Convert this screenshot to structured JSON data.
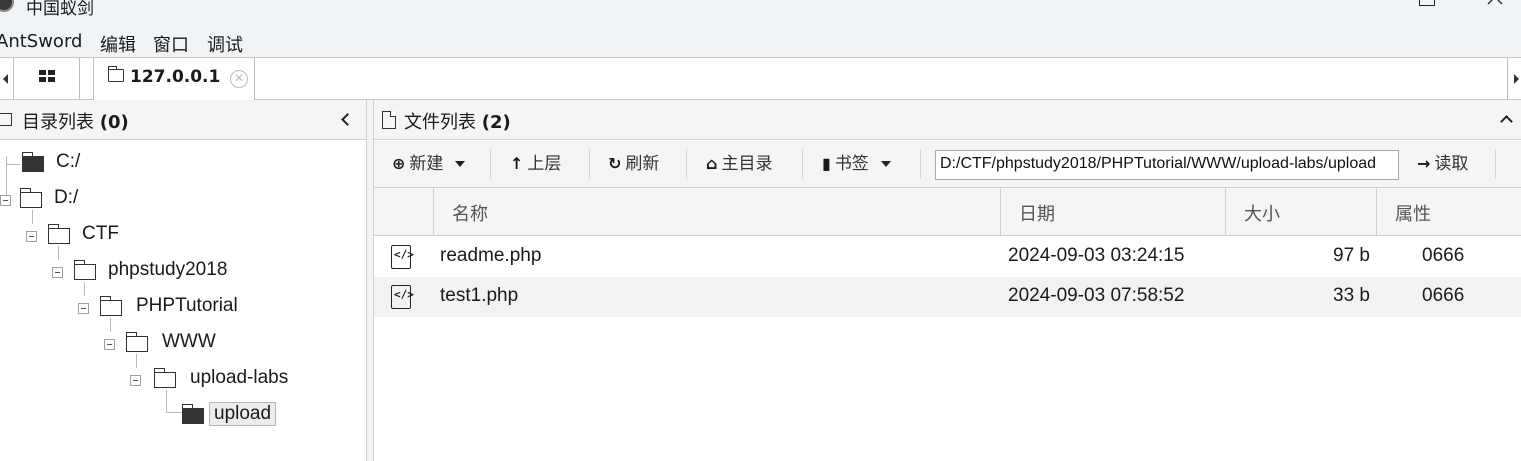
{
  "window": {
    "title": "中国蚁剑"
  },
  "menu": [
    "AntSword",
    "编辑",
    "窗口",
    "调试"
  ],
  "tabs": {
    "active_label": "127.0.0.1"
  },
  "left_panel": {
    "title": "目录列表",
    "count": "(0)",
    "tree": [
      {
        "label": "C:/",
        "solid": true
      },
      {
        "label": "D:/"
      },
      {
        "label": "CTF"
      },
      {
        "label": "phpstudy2018"
      },
      {
        "label": "PHPTutorial"
      },
      {
        "label": "WWW"
      },
      {
        "label": "upload-labs"
      },
      {
        "label": "upload",
        "solid": true,
        "selected": true
      }
    ]
  },
  "right_panel": {
    "title": "文件列表",
    "count": "(2)",
    "toolbar": {
      "new_label": "新建",
      "up_label": "上层",
      "refresh_label": "刷新",
      "home_label": "主目录",
      "bookmark_label": "书签",
      "read_label": "读取",
      "path_value": "D:/CTF/phpstudy2018/PHPTutorial/WWW/upload-labs/upload"
    },
    "columns": [
      "名称",
      "日期",
      "大小",
      "属性"
    ],
    "files": [
      {
        "name": "readme.php",
        "date": "2024-09-03 03:24:15",
        "size": "97 b",
        "attr": "0666"
      },
      {
        "name": "test1.php",
        "date": "2024-09-03 07:58:52",
        "size": "33 b",
        "attr": "0666"
      }
    ]
  },
  "icons": {
    "new": "plus-circle-icon",
    "up": "arrow-up-icon",
    "refresh": "refresh-icon",
    "home": "home-icon",
    "bookmark": "bookmark-icon",
    "read": "arrow-right-icon",
    "file": "php-file-icon"
  }
}
